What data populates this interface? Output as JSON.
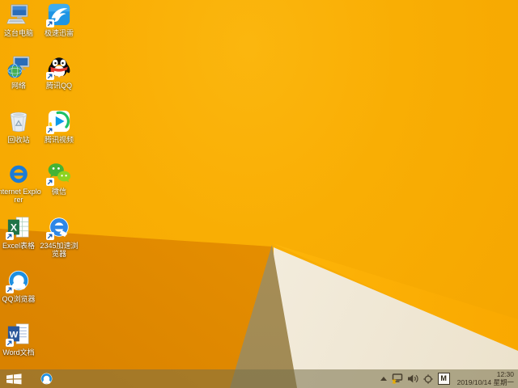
{
  "desktop": {
    "icons": [
      {
        "name": "this-pc",
        "label": "这台电脑",
        "col": 0,
        "row": 0,
        "shortcut": false
      },
      {
        "name": "xunlei",
        "label": "极速迅雷",
        "col": 1,
        "row": 0,
        "shortcut": true
      },
      {
        "name": "network",
        "label": "网络",
        "col": 0,
        "row": 1,
        "shortcut": false
      },
      {
        "name": "tencent-qq",
        "label": "腾讯QQ",
        "col": 1,
        "row": 1,
        "shortcut": true
      },
      {
        "name": "recycle-bin",
        "label": "回收站",
        "col": 0,
        "row": 2,
        "shortcut": false
      },
      {
        "name": "tencent-video",
        "label": "腾讯视频",
        "col": 1,
        "row": 2,
        "shortcut": true
      },
      {
        "name": "internet-explorer",
        "label": "Internet Explorer",
        "col": 0,
        "row": 3,
        "shortcut": false
      },
      {
        "name": "wechat",
        "label": "微信",
        "col": 1,
        "row": 3,
        "shortcut": true
      },
      {
        "name": "excel",
        "label": "Excel表格",
        "col": 0,
        "row": 4,
        "shortcut": true
      },
      {
        "name": "browser-2345",
        "label": "2345加速浏览器",
        "col": 1,
        "row": 4,
        "shortcut": true
      },
      {
        "name": "qq-browser",
        "label": "QQ浏览器",
        "col": 0,
        "row": 5,
        "shortcut": true
      },
      {
        "name": "word",
        "label": "Word文档",
        "col": 0,
        "row": 6,
        "shortcut": true
      }
    ]
  },
  "taskbar": {
    "pinned": [
      {
        "name": "qq-browser"
      }
    ],
    "tray": {
      "icons": [
        "hidden-icons",
        "network-status",
        "volume",
        "crosshair",
        "ime"
      ],
      "ime_label": "M"
    },
    "clock": {
      "time": "12:30",
      "date": "2019/10/14 星期一"
    }
  },
  "colors": {
    "wallpaper_main": "#F9AE04",
    "wallpaper_shadow": "#DD8800",
    "wallpaper_ridge": "#FFC62C",
    "wallpaper_cream": "#F3ECDC",
    "wallpaper_tan": "#A98F57",
    "taskbar_overlay": "rgba(118,110,72,0.54)",
    "taskbar_text": "#3A3122"
  }
}
